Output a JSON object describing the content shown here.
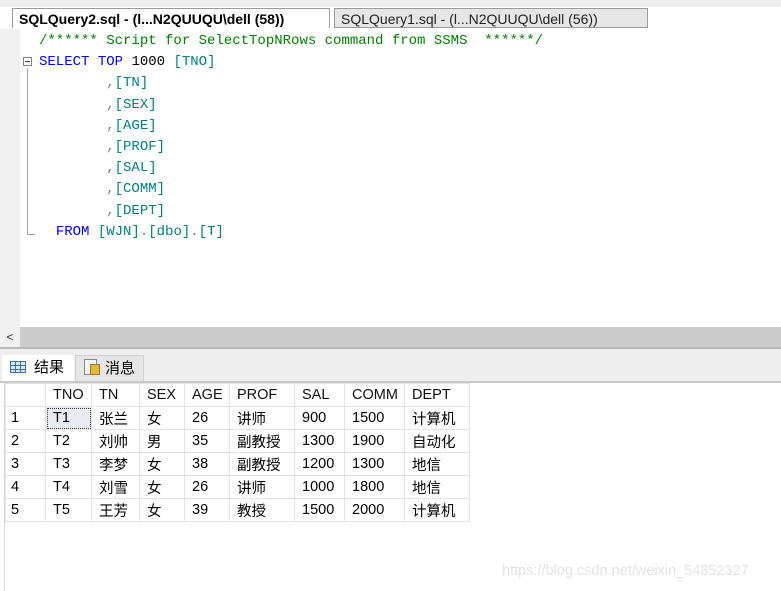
{
  "tabs": [
    {
      "label": "SQLQuery2.sql - (l...N2QUUQU\\dell (58))",
      "active": true
    },
    {
      "label": "SQLQuery1.sql - (l...N2QUUQU\\dell (56))",
      "active": false
    }
  ],
  "editor": {
    "comment": "/****** Script for SelectTopNRows command from SSMS  ******/",
    "select_kw": "SELECT",
    "top_kw": "TOP",
    "top_value": "1000",
    "first_column": "[TNO]",
    "columns": [
      "[TN]",
      "[SEX]",
      "[AGE]",
      "[PROF]",
      "[SAL]",
      "[COMM]",
      "[DEPT]"
    ],
    "from_kw": "FROM",
    "from_db": "[WJN]",
    "from_schema": "[dbo]",
    "from_table": "[T]"
  },
  "scrollbar": {
    "left_arrow": "<"
  },
  "result_tabs": [
    {
      "label": "结果",
      "icon": "grid-icon",
      "active": true
    },
    {
      "label": "消息",
      "icon": "messages-icon",
      "active": false
    }
  ],
  "results": {
    "columns": [
      "TNO",
      "TN",
      "SEX",
      "AGE",
      "PROF",
      "SAL",
      "COMM",
      "DEPT"
    ],
    "rows": [
      {
        "n": "1",
        "cells": [
          "T1",
          "张兰",
          "女",
          "26",
          "讲师",
          "900",
          "1500",
          "计算机"
        ]
      },
      {
        "n": "2",
        "cells": [
          "T2",
          "刘帅",
          "男",
          "35",
          "副教授",
          "1300",
          "1900",
          "自动化"
        ]
      },
      {
        "n": "3",
        "cells": [
          "T3",
          "李梦",
          "女",
          "38",
          "副教授",
          "1200",
          "1300",
          "地信"
        ]
      },
      {
        "n": "4",
        "cells": [
          "T4",
          "刘雪",
          "女",
          "26",
          "讲师",
          "1000",
          "1800",
          "地信"
        ]
      },
      {
        "n": "5",
        "cells": [
          "T5",
          "王芳",
          "女",
          "39",
          "教授",
          "1500",
          "2000",
          "计算机"
        ]
      }
    ]
  },
  "watermark": "https://blog.csdn.net/weixin_54852327"
}
